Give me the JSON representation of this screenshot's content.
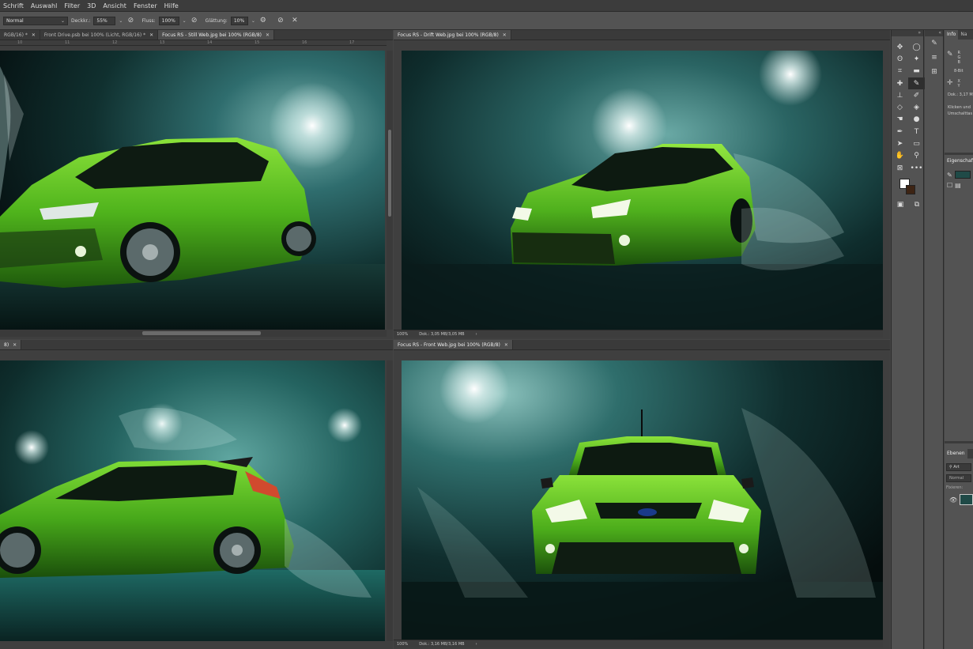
{
  "menu": [
    "Schrift",
    "Auswahl",
    "Filter",
    "3D",
    "Ansicht",
    "Fenster",
    "Hilfe"
  ],
  "options": {
    "mode": "Normal",
    "opacity_label": "Deckkr.:",
    "opacity_value": "55%",
    "flow_label": "Fluss:",
    "flow_value": "100%",
    "smoothing_label": "Glättung:",
    "smoothing_value": "10%"
  },
  "tabs_top_left": [
    {
      "label": "RGB/16) *",
      "active": false
    },
    {
      "label": "Front Drive.psb bei 100% (Licht, RGB/16) *",
      "active": false
    },
    {
      "label": "Focus RS - Still Web.jpg bei 100% (RGB/8)",
      "active": true
    }
  ],
  "tabs_top_right": [
    {
      "label": "Focus RS - Drift Web.jpg bei 100% (RGB/8)",
      "active": true
    }
  ],
  "tabs_bottom_left": [
    {
      "label": "8)",
      "active": true
    }
  ],
  "tabs_bottom_right": [
    {
      "label": "Focus RS - Front Web.jpg bei 100% (RGB/8)",
      "active": true
    }
  ],
  "ruler_ticks": [
    "10",
    "11",
    "12",
    "13",
    "14",
    "15",
    "16",
    "17"
  ],
  "status_top_right": {
    "zoom": "100%",
    "doc": "Dok.: 3,05 MB/3,05 MB"
  },
  "status_bottom_right": {
    "zoom": "100%",
    "doc": "Dok.: 3,16 MB/3,16 MB"
  },
  "info_panel": {
    "tabs": [
      "Info",
      "Na"
    ],
    "r": "R",
    "g": "G",
    "b": "B",
    "bits": "8-Bit",
    "x": "X",
    "y": "Y",
    "doc": "Dok.: 3,17 M",
    "hint1": "Klicken und",
    "hint2": "Umschalttas"
  },
  "properties_panel": {
    "title": "Eigenschaft"
  },
  "layers_panel": {
    "title": "Ebenen",
    "filter": "Art",
    "blend": "Normal",
    "lock": "Fixieren:"
  },
  "colors": {
    "foreground": "#ffffff",
    "background": "#3d2414",
    "car_green": "#59c322"
  }
}
